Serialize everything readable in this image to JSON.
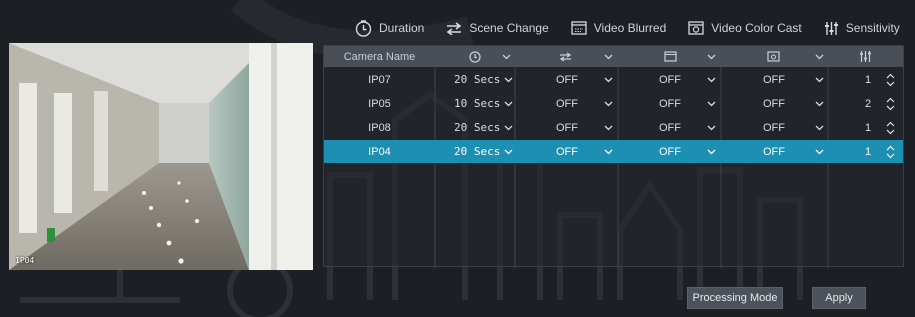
{
  "legend": {
    "duration": "Duration",
    "scene_change": "Scene Change",
    "video_blurred": "Video Blurred",
    "video_color_cast": "Video Color Cast",
    "sensitivity": "Sensitivity"
  },
  "preview": {
    "label": "IP04"
  },
  "table": {
    "header": {
      "camera_name": "Camera Name"
    },
    "rows": [
      {
        "camera": "IP07",
        "duration": "20 Secs",
        "scene_change": "OFF",
        "video_blurred": "OFF",
        "color_cast": "OFF",
        "sensitivity": "1"
      },
      {
        "camera": "IP05",
        "duration": "10 Secs",
        "scene_change": "OFF",
        "video_blurred": "OFF",
        "color_cast": "OFF",
        "sensitivity": "2"
      },
      {
        "camera": "IP08",
        "duration": "20 Secs",
        "scene_change": "OFF",
        "video_blurred": "OFF",
        "color_cast": "OFF",
        "sensitivity": "1"
      },
      {
        "camera": "IP04",
        "duration": "20 Secs",
        "scene_change": "OFF",
        "video_blurred": "OFF",
        "color_cast": "OFF",
        "sensitivity": "1"
      }
    ],
    "selected_index": 3
  },
  "buttons": {
    "processing_mode": "Processing Mode",
    "apply": "Apply"
  },
  "colors": {
    "selected_row": "#1d8fb3",
    "header_row": "#4a4f57",
    "background": "#1c1f24"
  }
}
